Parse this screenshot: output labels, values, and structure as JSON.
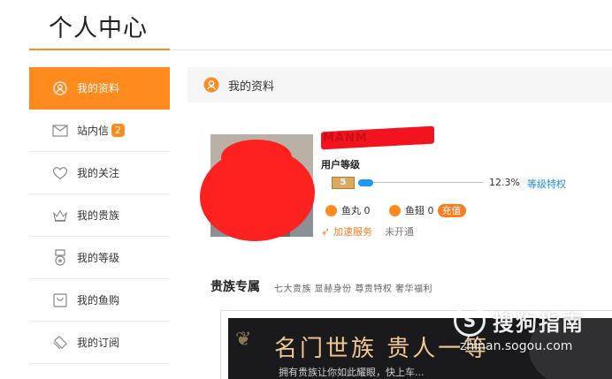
{
  "header": {
    "title": "个人中心"
  },
  "sidebar": {
    "items": [
      {
        "label": "我的资料",
        "icon": "user-icon",
        "active": true
      },
      {
        "label": "站内信",
        "icon": "mail-icon",
        "badge": "2"
      },
      {
        "label": "我的关注",
        "icon": "heart-icon"
      },
      {
        "label": "我的贵族",
        "icon": "crown-icon"
      },
      {
        "label": "我的等级",
        "icon": "medal-icon"
      },
      {
        "label": "我的鱼购",
        "icon": "bag-icon"
      },
      {
        "label": "我的订阅",
        "icon": "bookmark-icon"
      }
    ]
  },
  "main": {
    "section_title": "我的资料",
    "profile": {
      "name": "MANM",
      "level_label": "用户等级",
      "level": "5",
      "progress_pct": 12.3,
      "progress_text": "12.3%",
      "level_link": "等级特权",
      "fish_ball_label": "鱼丸",
      "fish_ball_value": "0",
      "fish_fin_label": "鱼翅",
      "fish_fin_value": "0",
      "recharge_label": "充值",
      "boost_label": "加速服务",
      "boost_status": "未开通"
    },
    "nobility": {
      "title": "贵族专属",
      "subtitle": "七大贵族 显赫身份 尊贵特权 奢华福利",
      "banner_headline": "名门世族 贵人一等",
      "banner_tagline": "拥有贵族让你如此耀眼，快上车..."
    }
  },
  "watermark": {
    "logo_glyph": "S",
    "text": "搜狗指南",
    "url": "zhinan.sogou.com"
  },
  "colors": {
    "accent": "#ff8a1e",
    "link": "#1b8ce8",
    "progress": "#1b9cf0"
  }
}
